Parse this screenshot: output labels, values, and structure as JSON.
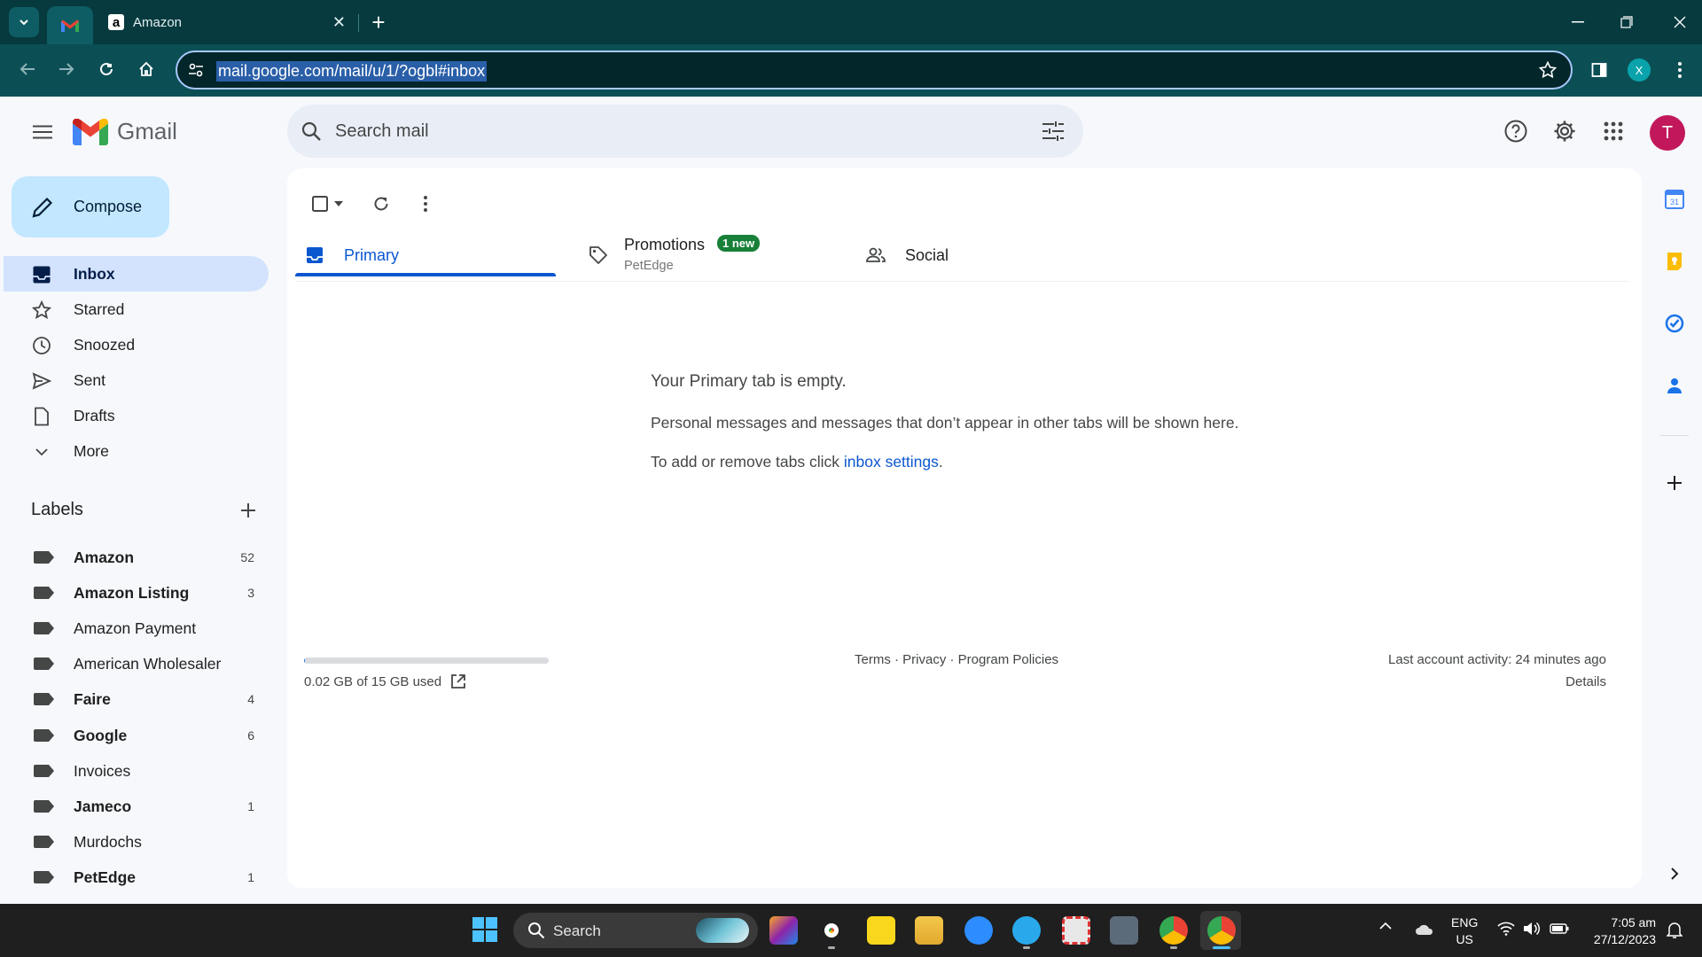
{
  "browser": {
    "tabs": [
      {
        "title": ""
      },
      {
        "title": "Amazon"
      }
    ],
    "new_tab": "+",
    "address": "mail.google.com/mail/u/1/?ogbl#inbox",
    "profile_initial": "X"
  },
  "gmail": {
    "product_name": "Gmail",
    "search_placeholder": "Search mail",
    "avatar_initial": "T"
  },
  "sidebar": {
    "compose_label": "Compose",
    "nav": [
      {
        "label": "Inbox",
        "icon": "inbox-icon",
        "active": true
      },
      {
        "label": "Starred",
        "icon": "star-icon"
      },
      {
        "label": "Snoozed",
        "icon": "clock-icon"
      },
      {
        "label": "Sent",
        "icon": "send-icon"
      },
      {
        "label": "Drafts",
        "icon": "draft-icon"
      },
      {
        "label": "More",
        "icon": "chevron-down-icon"
      }
    ],
    "labels_title": "Labels",
    "labels": [
      {
        "label": "Amazon",
        "count": "52",
        "bold": true
      },
      {
        "label": "Amazon Listing",
        "count": "3",
        "bold": true
      },
      {
        "label": "Amazon Payment",
        "count": "",
        "bold": false
      },
      {
        "label": "American Wholesaler",
        "count": "",
        "bold": false
      },
      {
        "label": "Faire",
        "count": "4",
        "bold": true
      },
      {
        "label": "Google",
        "count": "6",
        "bold": true
      },
      {
        "label": "Invoices",
        "count": "",
        "bold": false
      },
      {
        "label": "Jameco",
        "count": "1",
        "bold": true
      },
      {
        "label": "Murdochs",
        "count": "",
        "bold": false
      },
      {
        "label": "PetEdge",
        "count": "1",
        "bold": true
      }
    ]
  },
  "main": {
    "tabs": {
      "primary": "Primary",
      "promotions": "Promotions",
      "promotions_badge": "1 new",
      "promotions_sub": "PetEdge",
      "social": "Social"
    },
    "empty_title": "Your Primary tab is empty.",
    "empty_desc": "Personal messages and messages that don’t appear in other tabs will be shown here.",
    "empty_hint_prefix": "To add or remove tabs click ",
    "empty_hint_link": "inbox settings",
    "empty_hint_suffix": ".",
    "storage_text": "0.02 GB of 15 GB used",
    "storage_fraction": 0.0013,
    "footer_links": "Terms · Privacy · Program Policies",
    "last_activity": "Last account activity: 24 minutes ago",
    "details": "Details"
  },
  "taskbar": {
    "search_label": "Search",
    "lang_line1": "ENG",
    "lang_line2": "US",
    "time": "7:05 am",
    "date": "27/12/2023"
  },
  "colors": {
    "accent": "#0b57d0",
    "compose_bg": "#c2e7ff",
    "active_nav_bg": "#d3e3fd",
    "badge_green": "#188038",
    "avatar": "#c2185b"
  }
}
